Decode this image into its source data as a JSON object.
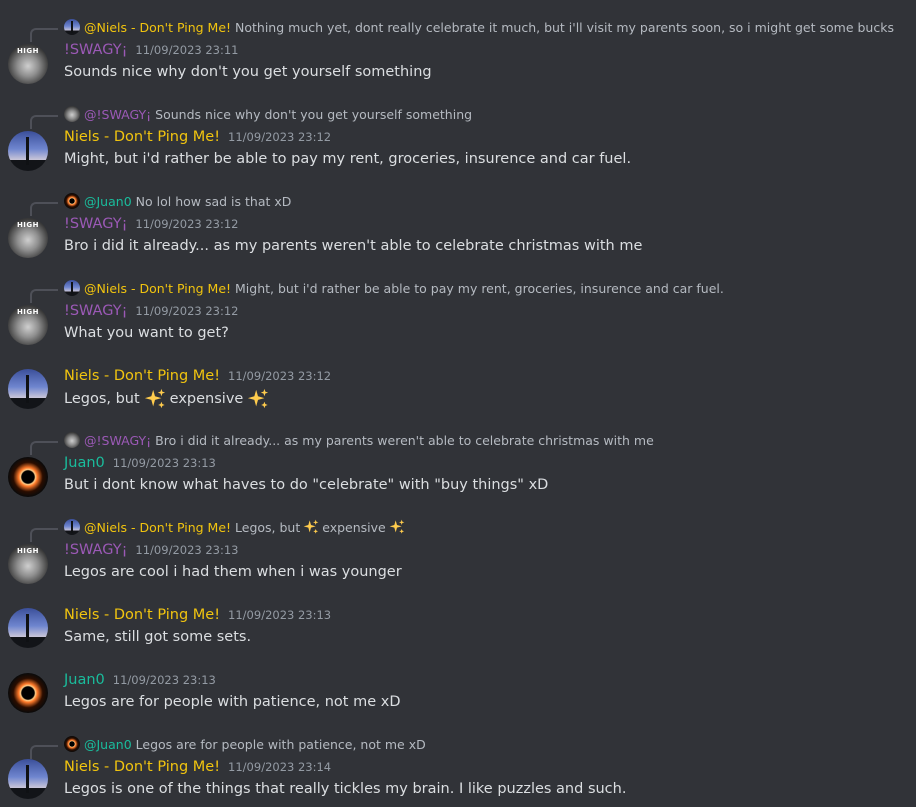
{
  "colors": {
    "background": "#313338",
    "niels": "#f1c40f",
    "swagy": "#9b59b6",
    "juan": "#1abc9c",
    "timestamp": "#949ba4",
    "text": "#dbdee1",
    "reply_text": "#b5bac1"
  },
  "messages": [
    {
      "reply": {
        "avatar": "niels-avatar-icon",
        "name": "@Niels - Don't Ping Me!",
        "text": "Nothing much yet, dont really celebrate it much, but i'll visit my parents soon, so i might get some bucks"
      },
      "author": "!SWAGY¡",
      "timestamp": "11/09/2023 23:11",
      "text": "Sounds nice why don't you get yourself something"
    },
    {
      "reply": {
        "avatar": "swagy-avatar-icon",
        "name": "@!SWAGY¡",
        "text": "Sounds nice why don't you get yourself something"
      },
      "author": "Niels - Don't Ping Me!",
      "timestamp": "11/09/2023 23:12",
      "text": "Might, but i'd rather be able to pay my rent, groceries, insurence and car fuel."
    },
    {
      "reply": {
        "avatar": "juan-avatar-icon",
        "name": "@Juan0",
        "text": "No lol how sad is that xD"
      },
      "author": "!SWAGY¡",
      "timestamp": "11/09/2023 23:12",
      "text": "Bro i did it already... as my parents weren't able to celebrate christmas with me"
    },
    {
      "reply": {
        "avatar": "niels-avatar-icon",
        "name": "@Niels - Don't Ping Me!",
        "text": "Might, but i'd rather be able to pay my rent, groceries, insurence and car fuel."
      },
      "author": "!SWAGY¡",
      "timestamp": "11/09/2023 23:12",
      "text": "What you want to get?"
    },
    {
      "author": "Niels - Don't Ping Me!",
      "timestamp": "11/09/2023 23:12",
      "text_parts": [
        "Legos, but",
        "expensive"
      ],
      "emoji": "sparkles-icon"
    },
    {
      "reply": {
        "avatar": "swagy-avatar-icon",
        "name": "@!SWAGY¡",
        "text": "Bro i did it already... as my parents weren't able to celebrate christmas with me"
      },
      "author": "Juan0",
      "timestamp": "11/09/2023 23:13",
      "text": "But i dont know what haves to do \"celebrate\" with \"buy things\" xD"
    },
    {
      "reply": {
        "avatar": "niels-avatar-icon",
        "name": "@Niels - Don't Ping Me!",
        "text_parts": [
          "Legos, but",
          "expensive"
        ]
      },
      "author": "!SWAGY¡",
      "timestamp": "11/09/2023 23:13",
      "text": "Legos are cool i had them when i was younger"
    },
    {
      "author": "Niels - Don't Ping Me!",
      "timestamp": "11/09/2023 23:13",
      "text": "Same, still got some sets."
    },
    {
      "author": "Juan0",
      "timestamp": "11/09/2023 23:13",
      "text": "Legos are for people with patience, not me xD"
    },
    {
      "reply": {
        "avatar": "juan-avatar-icon",
        "name": "@Juan0",
        "text": "Legos are for people with patience, not me xD"
      },
      "author": "Niels - Don't Ping Me!",
      "timestamp": "11/09/2023 23:14",
      "text": "Legos is one of the things that really tickles my brain. I like puzzles and such."
    }
  ]
}
